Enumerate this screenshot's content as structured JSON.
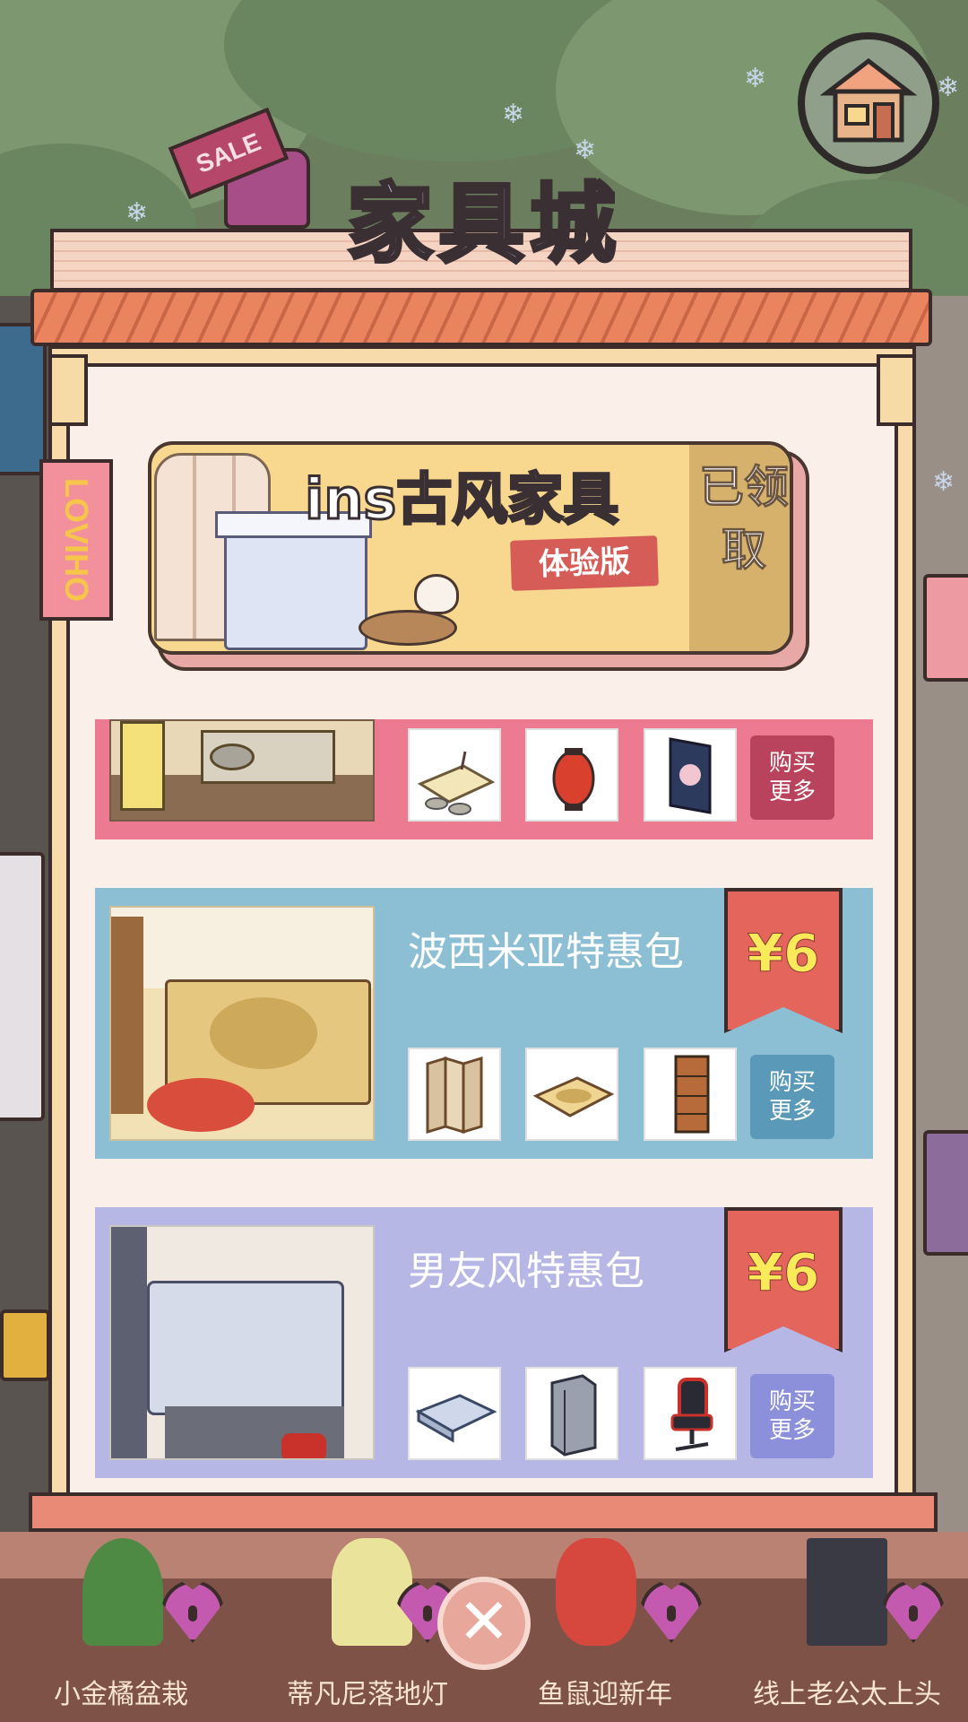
{
  "shop": {
    "title": "家具城",
    "side_sign": "LOVIHO"
  },
  "sale_sign": "SALE",
  "banner": {
    "title": "ins古风家具",
    "tag": "体验版",
    "status": "已领取"
  },
  "packs": [
    {
      "name": "",
      "price": "",
      "buy_label": "购买\n更多",
      "color": "#ec7b92",
      "button_color": "#b9435c",
      "items": [
        "tea-table-icon",
        "red-lantern-icon",
        "hanging-scroll-icon"
      ]
    },
    {
      "name": "波西米亚特惠包",
      "price": "¥6",
      "buy_label": "购买\n更多",
      "color": "#8dbfd4",
      "button_color": "#5a9ab8",
      "items": [
        "folding-screen-icon",
        "bohemian-bed-icon",
        "shelf-cabinet-icon"
      ]
    },
    {
      "name": "男友风特惠包",
      "price": "¥6",
      "buy_label": "购买\n更多",
      "color": "#b6b7e4",
      "button_color": "#8c8fd9",
      "items": [
        "blue-bed-icon",
        "wardrobe-icon",
        "gaming-chair-icon"
      ]
    }
  ],
  "bottom_items": [
    {
      "label": "小金橘盆栽",
      "icon": "potted-kumquat-icon"
    },
    {
      "label": "蒂凡尼落地灯",
      "icon": "floor-lamp-icon"
    },
    {
      "label": "鱼鼠迎新年",
      "icon": "lion-dance-icon"
    },
    {
      "label": "线上老公太上头",
      "icon": "poster-icon"
    }
  ],
  "icons": {
    "home": "house-icon",
    "close": "close-icon",
    "lock": "heart-lock-icon"
  }
}
